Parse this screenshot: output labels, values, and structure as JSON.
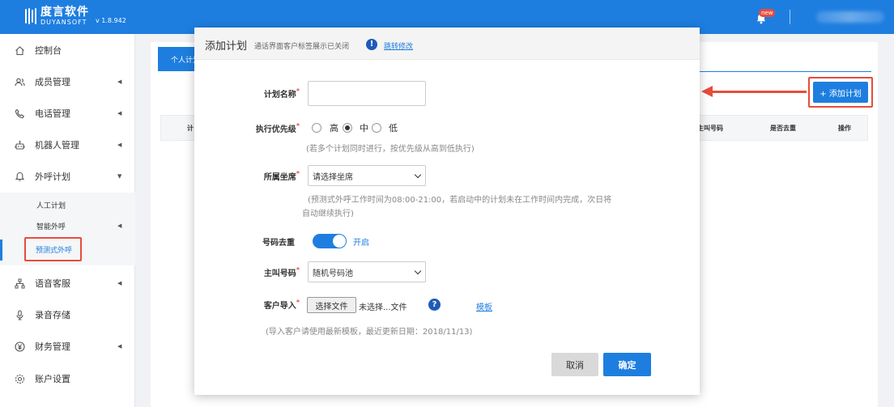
{
  "header": {
    "brand_cn": "度言软件",
    "brand_en": "DUYANSOFT",
    "version": "v 1.8.942",
    "notification_badge": "new",
    "icons": [
      "logo-icon",
      "bell-icon"
    ]
  },
  "sidebar": {
    "items": [
      {
        "label": "控制台",
        "icon": "home-icon"
      },
      {
        "label": "成员管理",
        "icon": "users-icon"
      },
      {
        "label": "电话管理",
        "icon": "phone-icon"
      },
      {
        "label": "机器人管理",
        "icon": "robot-icon"
      },
      {
        "label": "外呼计划",
        "icon": "bell-outline-icon"
      },
      {
        "label": "语音客服",
        "icon": "network-icon"
      },
      {
        "label": "录音存储",
        "icon": "microphone-icon"
      },
      {
        "label": "财务管理",
        "icon": "yen-icon"
      },
      {
        "label": "账户设置",
        "icon": "gear-icon"
      }
    ],
    "submenu": [
      {
        "label": "人工计划"
      },
      {
        "label": "智能外呼"
      },
      {
        "label": "预测式外呼"
      }
    ]
  },
  "main": {
    "tab_label": "个人计划",
    "add_plan_label": "+ 添加计划",
    "columns": [
      "计",
      "主叫号码",
      "是否去重",
      "操作"
    ]
  },
  "modal": {
    "title": "添加计划",
    "subtitle": "通话界面客户标签展示已关闭",
    "jump_link": "跳转修改",
    "required_mark": "*",
    "fields": {
      "plan_name_label": "计划名称",
      "priority_label": "执行优先级",
      "priority_options": [
        "高",
        "中",
        "低"
      ],
      "priority_selected": "中",
      "priority_hint": "(若多个计划同时进行，按优先级从高到低执行)",
      "seat_label": "所属坐席",
      "seat_value": "请选择坐席",
      "seat_hint_1": "(预测式外呼工作时间为08:00-21:00，若启动中的计划未在工作时间内完成，次日将",
      "seat_hint_2": "自动继续执行)",
      "dedupe_label": "号码去重",
      "dedupe_state": "开启",
      "caller_label": "主叫号码",
      "caller_value": "随机号码池",
      "import_label": "客户导入",
      "file_button": "选择文件",
      "file_status": "未选择...文件",
      "template_link": "模板",
      "import_hint": "(导入客户请使用最新模板，最近更新日期：2018/11/13)"
    },
    "cancel_label": "取消",
    "ok_label": "确定"
  },
  "colors": {
    "primary": "#1e7ee0",
    "annotation": "#e74c3c"
  }
}
